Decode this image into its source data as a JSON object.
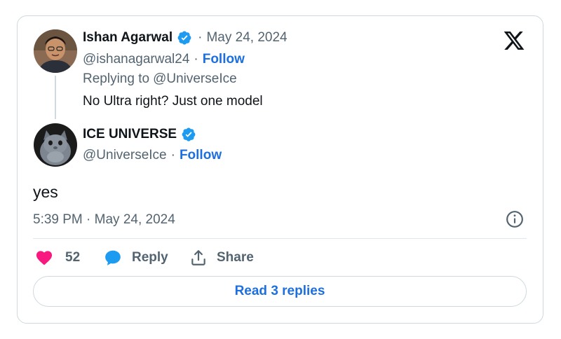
{
  "reply_tweet": {
    "author_name": "Ishan Agarwal",
    "separator": "·",
    "date": "May 24, 2024",
    "handle": "@ishanagarwal24",
    "follow_label": "Follow",
    "replying_to_prefix": "Replying to",
    "replying_to_handle": "@UniverseIce",
    "text": "No Ultra right? Just one model"
  },
  "main_tweet": {
    "author_name": "ICE UNIVERSE",
    "handle": "@UniverseIce",
    "separator": "·",
    "follow_label": "Follow",
    "text": "yes",
    "timestamp": "5:39 PM · May 24, 2024"
  },
  "actions": {
    "likes_count": "52",
    "reply_label": "Reply",
    "share_label": "Share"
  },
  "read_replies_label": "Read 3 replies",
  "icons": {
    "brand": "x-logo-icon",
    "verified": "verified-badge-icon",
    "like": "heart-icon",
    "reply": "chat-bubble-icon",
    "share": "share-upload-icon",
    "info": "info-icon"
  },
  "colors": {
    "link_blue": "#1d6fe0",
    "verified_blue": "#1d9bf0",
    "like_pink": "#f91880",
    "muted_text": "#536471",
    "border": "#cfd9de"
  }
}
